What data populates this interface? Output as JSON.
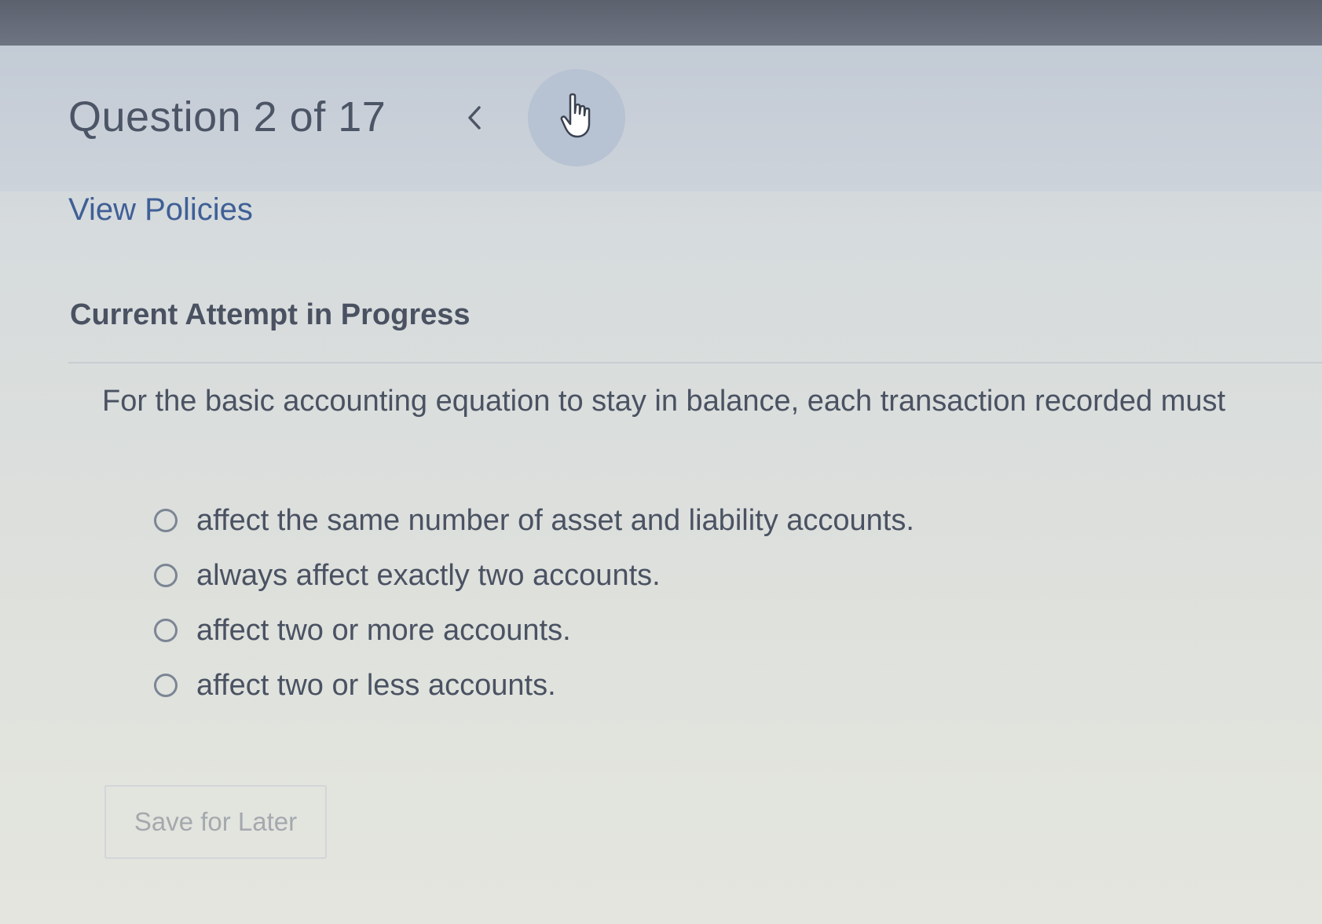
{
  "header": {
    "question_counter": "Question 2 of 17",
    "prev_icon": "chevron-left-icon",
    "cursor_icon": "hand-pointer-icon"
  },
  "policies_link": "View Policies",
  "attempt_status": "Current Attempt in Progress",
  "question": {
    "prompt": "For the basic accounting equation to stay in balance, each transaction recorded must",
    "options": [
      "affect the same number of asset and liability accounts.",
      "always affect exactly two accounts.",
      "affect two or more accounts.",
      "affect two or less accounts."
    ],
    "selected_index": null
  },
  "actions": {
    "save_label": "Save for Later"
  },
  "colors": {
    "link": "#3f5f96",
    "text": "#4a5262",
    "top_bar": "#626874",
    "header_band": "#c7ced8",
    "disabled_text": "#a4a9ae"
  }
}
